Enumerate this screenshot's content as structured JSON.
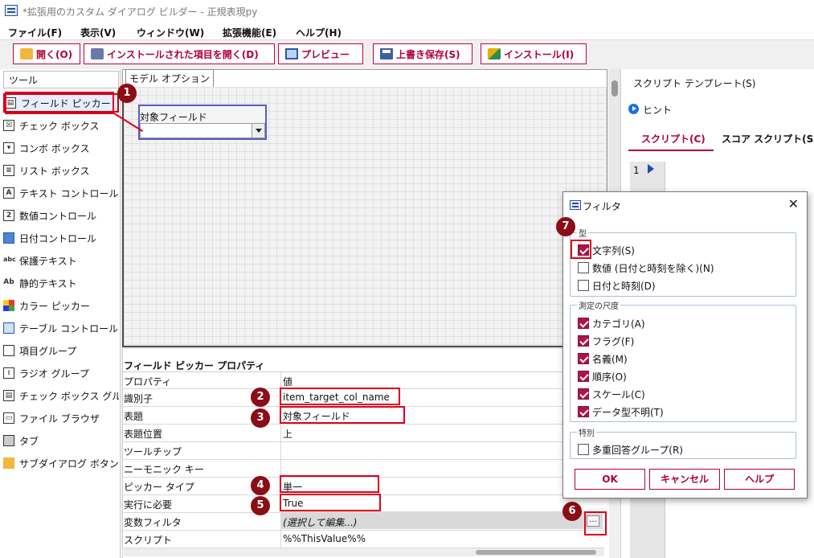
{
  "window": {
    "title": "*拡張用のカスタム ダイアログ ビルダー - 正規表現py"
  },
  "menu": [
    "ファイル(F)",
    "表示(V)",
    "ウィンドウ(W)",
    "拡張機能(E)",
    "ヘルプ(H)"
  ],
  "toolbar": {
    "open": "開く(O)",
    "open_installed": "インストールされた項目を開く(D)",
    "preview": "プレビュー",
    "save_overwrite": "上書き保存(S)",
    "install": "インストール(I)"
  },
  "tools": {
    "header": "ツール",
    "items": [
      "フィールド ピッカー",
      "チェック ボックス",
      "コンボ ボックス",
      "リスト ボックス",
      "テキスト コントロール",
      "数値コントロール",
      "日付コントロール",
      "保護テキスト",
      "静的テキスト",
      "カラー ピッカー",
      "テーブル コントロール",
      "項目グループ",
      "ラジオ グループ",
      "チェック ボックス グル",
      "ファイル ブラウザ",
      "タブ",
      "サブダイアログ ボタン"
    ]
  },
  "canvas": {
    "tab": "モデル オプション",
    "field_label": "対象フィールド"
  },
  "properties": {
    "title": "フィールド ピッカー プロパティ",
    "col_property": "プロパティ",
    "col_value": "値",
    "rows": [
      {
        "key": "識別子",
        "value": "item_target_col_name"
      },
      {
        "key": "表題",
        "value": "対象フィールド"
      },
      {
        "key": "表題位置",
        "value": "上"
      },
      {
        "key": "ツールチップ",
        "value": ""
      },
      {
        "key": "ニーモニック キー",
        "value": ""
      },
      {
        "key": "ピッカー タイプ",
        "value": "単一"
      },
      {
        "key": "実行に必要",
        "value": "True"
      },
      {
        "key": "変数フィルタ",
        "value": "(選択して編集...)"
      },
      {
        "key": "スクリプト",
        "value": "%%ThisValue%%"
      }
    ],
    "dots_button": "..."
  },
  "script_panel": {
    "template": "スクリプト テンプレート(S)",
    "hint": "ヒント",
    "tab_script": "スクリプト(C)",
    "tab_score": "スコア スクリプト(S",
    "line_number": "1"
  },
  "dialog": {
    "title": "フィルタ",
    "close": "✕",
    "group_type": "型",
    "type_options": [
      {
        "label": "文字列(S)",
        "checked": true
      },
      {
        "label": "数値 (日付と時刻を除く)(N)",
        "checked": false
      },
      {
        "label": "日付と時刻(D)",
        "checked": false
      }
    ],
    "group_measure": "測定の尺度",
    "measure_options": [
      {
        "label": "カテゴリ(A)",
        "checked": true
      },
      {
        "label": "フラグ(F)",
        "checked": true
      },
      {
        "label": "名義(M)",
        "checked": true
      },
      {
        "label": "順序(O)",
        "checked": true
      },
      {
        "label": "スケール(C)",
        "checked": true
      },
      {
        "label": "データ型不明(T)",
        "checked": true
      }
    ],
    "group_special": "特別",
    "special_options": [
      {
        "label": "多重回答グループ(R)",
        "checked": false
      }
    ],
    "ok": "OK",
    "cancel": "キャンセル",
    "help": "ヘルプ"
  },
  "badges": [
    "1",
    "2",
    "3",
    "4",
    "5",
    "6",
    "7"
  ],
  "colors": {
    "accent": "#b0003a",
    "annotation_red": "#e0001b",
    "badge": "#8b0d16"
  }
}
